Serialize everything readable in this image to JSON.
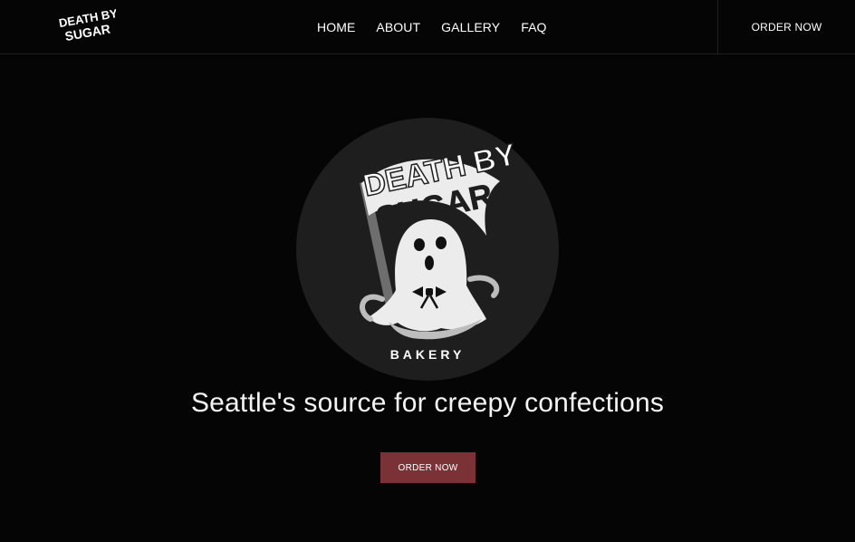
{
  "brand": {
    "name": "DEATH BY SUGAR",
    "logo_line1": "DEATH BY",
    "logo_line2": "SUGAR",
    "logo_sub": "BAKERY"
  },
  "nav": {
    "links": [
      "HOME",
      "ABOUT",
      "GALLERY",
      "FAQ"
    ],
    "order_label": "ORDER NOW"
  },
  "hero": {
    "tagline": "Seattle's source for creepy confections",
    "cta_label": "ORDER NOW"
  },
  "colors": {
    "background": "#050505",
    "accent": "#7b3236",
    "logo_circle": "#1e1e1e"
  },
  "icons": {
    "hero_mascot": "ghost-with-scythe-icon"
  }
}
